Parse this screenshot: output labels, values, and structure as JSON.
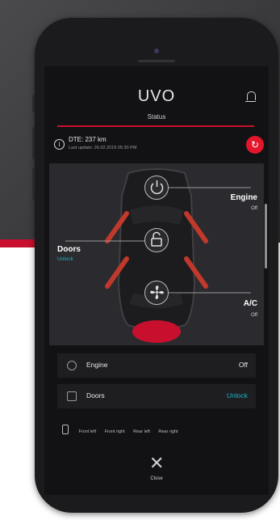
{
  "app": {
    "logo": "UVO",
    "subtitle": "Status"
  },
  "summary": {
    "dte": "DTE: 237 km",
    "last_update": "Last update: 26.02.2019 05:30 PM"
  },
  "controls": {
    "engine": {
      "label": "Engine",
      "state": "Off"
    },
    "doors": {
      "label": "Doors",
      "state": "Unlock"
    },
    "ac": {
      "label": "A/C",
      "state": "Off"
    }
  },
  "rows": {
    "engine": {
      "label": "Engine",
      "value": "Off"
    },
    "doors": {
      "label": "Doors",
      "value": "Unlock"
    }
  },
  "door_positions": [
    "Front left",
    "Front right",
    "Rear left",
    "Rear right"
  ],
  "close": {
    "label": "Close"
  },
  "colors": {
    "accent_red": "#c8102e",
    "unlock_teal": "#19b4c8",
    "refresh_red": "#e3162c"
  }
}
